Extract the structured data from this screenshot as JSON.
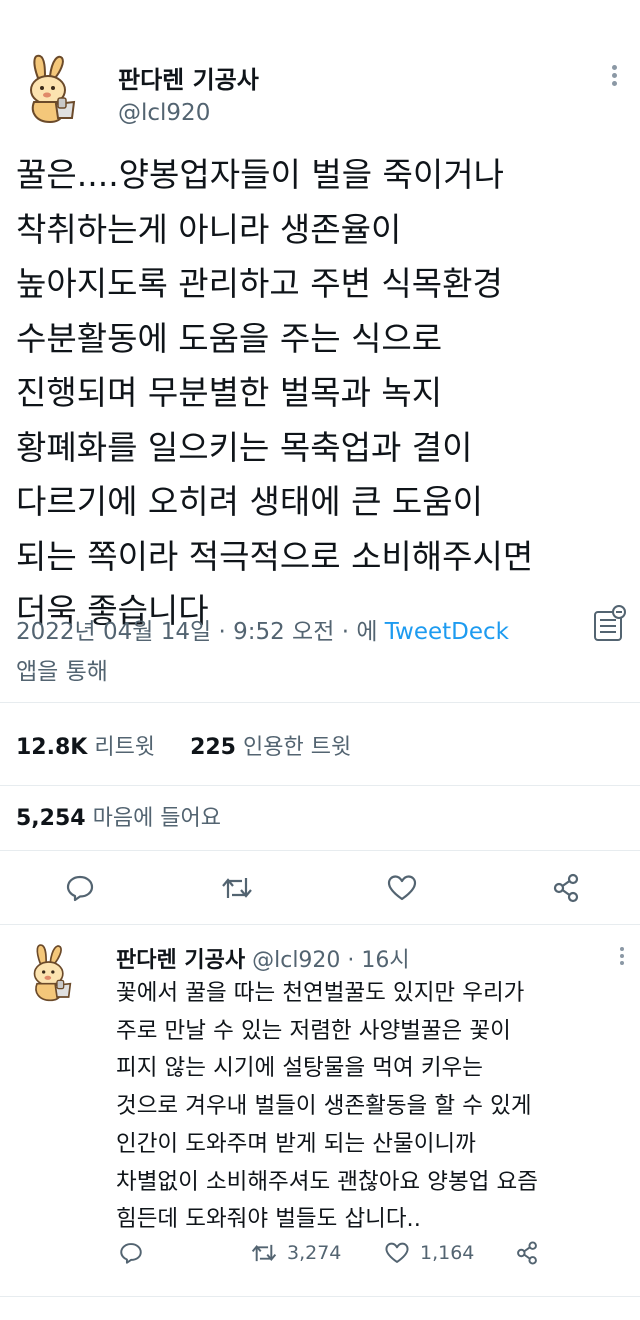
{
  "main_tweet": {
    "author_name": "판다렌 기공사",
    "author_handle": "@lcl920",
    "text": "꿀은....양봉업자들이 벌을 죽이거나\n착취하는게 아니라 생존율이\n높아지도록 관리하고 주변 식목환경\n수분활동에 도움을 주는 식으로\n진행되며 무분별한 벌목과 녹지\n황폐화를 일으키는 목축업과 결이\n다르기에 오히려 생태에 큰 도움이\n되는 쪽이라 적극적으로 소비해주시면\n더욱 좋습니다",
    "timestamp": "2022년 04월 14일 · 9:52 오전 · 에 ",
    "source": "TweetDeck",
    "source_suffix": "앱을 통해",
    "retweets_count": "12.8K",
    "retweets_label": "리트윗",
    "quotes_count": "225",
    "quotes_label": "인용한 트윗",
    "likes_count": "5,254",
    "likes_label": "마음에 들어요"
  },
  "reply_tweet": {
    "author_name": "판다렌 기공사",
    "author_handle": "@lcl920 · 16시",
    "text": "꽃에서 꿀을 따는 천연벌꿀도 있지만 우리가\n주로 만날 수 있는 저렴한 사양벌꿀은 꽃이\n피지 않는 시기에 설탕물을 먹여 키우는\n것으로 겨우내 벌들이 생존활동을 할 수 있게\n인간이 도와주며 받게 되는 산물이니까\n차별없이 소비해주셔도 괜찮아요 양봉업 요즘\n힘든데 도와줘야 벌들도 삽니다..",
    "retweets_count": "3,274",
    "likes_count": "1,164"
  },
  "colors": {
    "text": "#0f1419",
    "secondary": "#536471",
    "link": "#1d9bf0",
    "divider": "#e7ecef"
  },
  "icons": [
    "more-icon",
    "tweetdeck-icon",
    "reply-icon",
    "retweet-icon",
    "like-icon",
    "share-icon"
  ]
}
